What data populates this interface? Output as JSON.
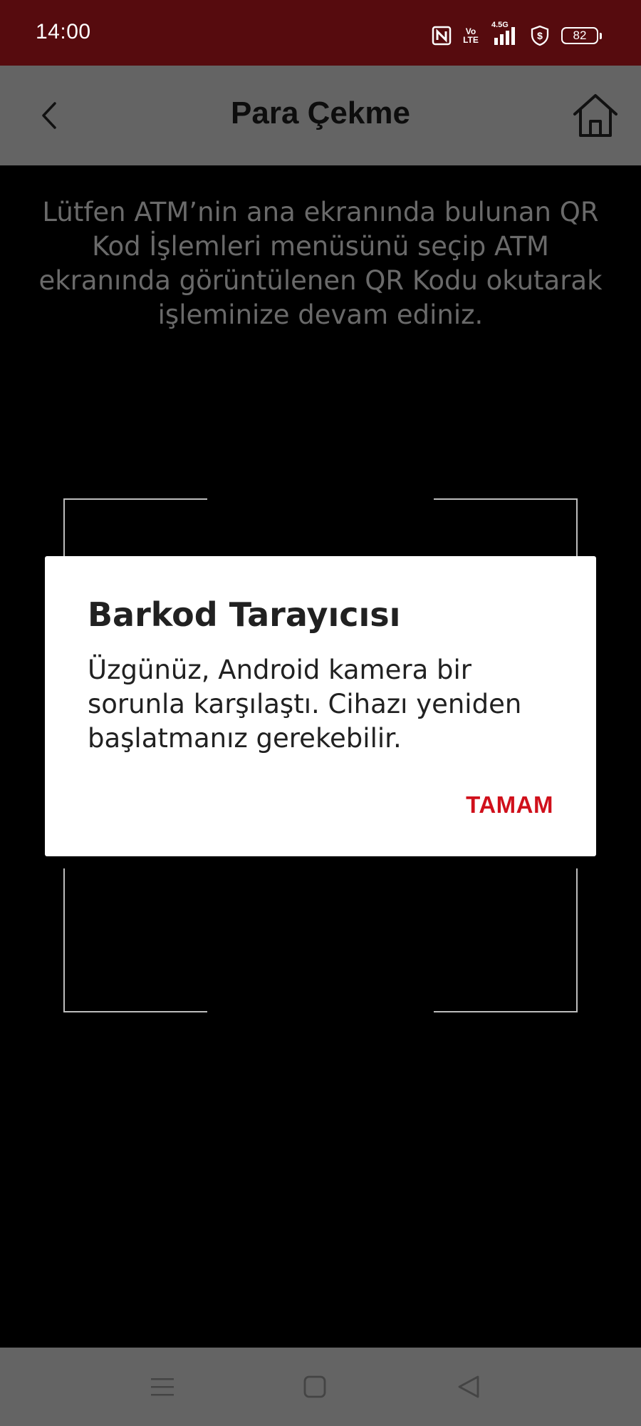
{
  "status_bar": {
    "time": "14:00",
    "network_label": "4.5G",
    "volte_label": "Vo LTE",
    "battery_level": "82"
  },
  "header": {
    "title": "Para Çekme"
  },
  "scanner": {
    "instructions": "Lütfen ATM’nin ana ekranında bulunan QR Kod İşlemleri menüsünü seçip ATM ekranında görüntülenen QR Kodu okutarak işleminize devam ediniz."
  },
  "dialog": {
    "title": "Barkod Tarayıcısı",
    "message": "Üzgünüz, Android kamera bir sorunla karşılaştı. Cihazı yeniden başlatmanız gerekebilir.",
    "ok_label": "TAMAM"
  },
  "colors": {
    "status_bar_bg": "#560b0e",
    "app_bar_bg": "#646464",
    "accent": "#d0101b"
  },
  "icons": {
    "back": "chevron-left-icon",
    "home": "home-icon",
    "nav_recents": "menu-icon",
    "nav_home": "square-icon",
    "nav_back": "triangle-back-icon"
  }
}
